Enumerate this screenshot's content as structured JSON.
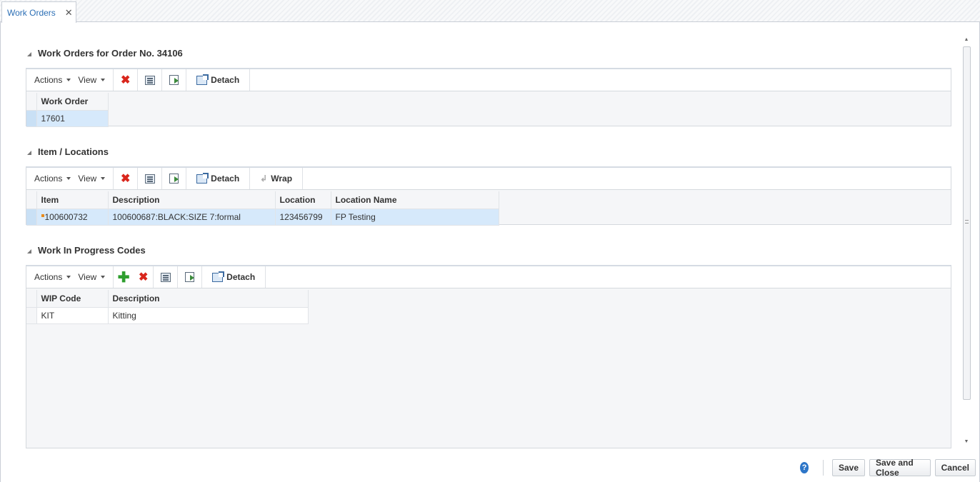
{
  "tab": {
    "label": "Work Orders",
    "close": "✕"
  },
  "toolbar": {
    "actions_label": "Actions",
    "view_label": "View",
    "detach_label": "Detach",
    "wrap_label": "Wrap"
  },
  "sections": {
    "work_orders": {
      "title": "Work Orders for Order No. 34106",
      "columns": [
        "Work Order"
      ],
      "rows": [
        [
          "17601"
        ]
      ]
    },
    "item_locations": {
      "title": "Item / Locations",
      "columns": [
        "Item",
        "Description",
        "Location",
        "Location Name"
      ],
      "rows": [
        [
          "100600732",
          "100600687:BLACK:SIZE 7:formal",
          "123456799",
          "FP Testing"
        ]
      ]
    },
    "wip_codes": {
      "title": "Work In Progress Codes",
      "columns": [
        "WIP Code",
        "Description"
      ],
      "rows": [
        [
          "KIT",
          "Kitting"
        ]
      ]
    }
  },
  "footer": {
    "help": "?",
    "save_label": "Save",
    "save_close_label": "Save and Close",
    "cancel_label": "Cancel"
  }
}
